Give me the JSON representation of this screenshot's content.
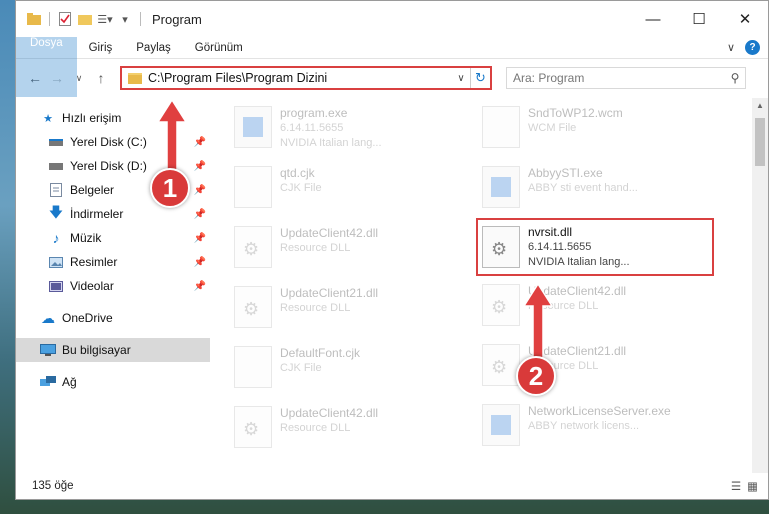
{
  "window": {
    "title": "Program"
  },
  "ribbon": {
    "tabs": [
      "Dosya",
      "Giriş",
      "Paylaş",
      "Görünüm"
    ],
    "expand_icon": "chevron-down-icon",
    "help_label": "?"
  },
  "nav": {
    "address": "C:\\Program Files\\Program Dizini",
    "search_placeholder": "Ara: Program"
  },
  "sidebar": {
    "quick_access_label": "Hızlı erişim",
    "items": [
      {
        "label": "Yerel Disk (C:)",
        "icon": "drive-icon"
      },
      {
        "label": "Yerel Disk (D:)",
        "icon": "drive-icon"
      },
      {
        "label": "Belgeler",
        "icon": "documents-icon"
      },
      {
        "label": "İndirmeler",
        "icon": "download-icon"
      },
      {
        "label": "Müzik",
        "icon": "music-icon"
      },
      {
        "label": "Resimler",
        "icon": "pictures-icon"
      },
      {
        "label": "Videolar",
        "icon": "videos-icon"
      }
    ],
    "onedrive_label": "OneDrive",
    "thispc_label": "Bu bilgisayar",
    "network_label": "Ağ"
  },
  "files": {
    "left": [
      {
        "name": "program.exe",
        "line2": "6.14.11.5655",
        "line3": "NVIDIA Italian lang...",
        "type": "exe"
      },
      {
        "name": "qtd.cjk",
        "line2": "CJK File",
        "line3": "",
        "type": "doc"
      },
      {
        "name": "UpdateClient42.dll",
        "line2": "Resource DLL",
        "line3": "",
        "type": "dll"
      },
      {
        "name": "UpdateClient21.dll",
        "line2": "Resource DLL",
        "line3": "",
        "type": "dll"
      },
      {
        "name": "DefaultFont.cjk",
        "line2": "CJK File",
        "line3": "",
        "type": "doc"
      },
      {
        "name": "UpdateClient42.dll",
        "line2": "Resource DLL",
        "line3": "",
        "type": "dll"
      }
    ],
    "right": [
      {
        "name": "SndToWP12.wcm",
        "line2": "WCM File",
        "line3": "",
        "type": "doc"
      },
      {
        "name": "AbbyySTI.exe",
        "line2": "ABBY sti event hand...",
        "line3": "",
        "type": "exe"
      },
      {
        "name": "nvrsit.dll",
        "line2": "6.14.11.5655",
        "line3": "NVIDIA Italian lang...",
        "type": "dll",
        "highlight": true
      },
      {
        "name": "UpdateClient42.dll",
        "line2": "Resource DLL",
        "line3": "",
        "type": "dll"
      },
      {
        "name": "UpdateClient21.dll",
        "line2": "Resource DLL",
        "line3": "",
        "type": "dll"
      },
      {
        "name": "NetworkLicenseServer.exe",
        "line2": "ABBY network licens...",
        "line3": "",
        "type": "exe"
      }
    ]
  },
  "status": {
    "count": "135 öğe"
  },
  "annotations": {
    "badge1": "1",
    "badge2": "2"
  },
  "colors": {
    "accent": "#1979ca",
    "annotation_red": "#d93a3a"
  }
}
